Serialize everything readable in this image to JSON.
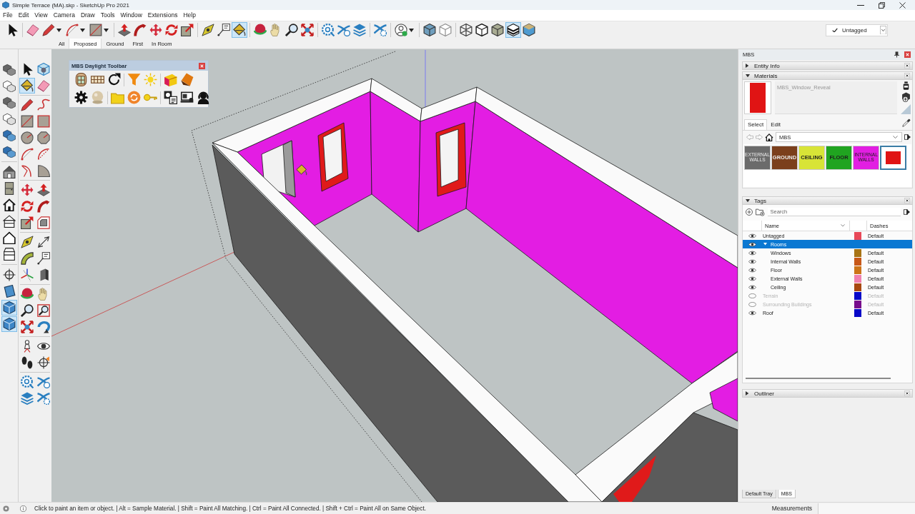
{
  "window": {
    "title": "Simple Terrace (MA).skp - SketchUp Pro 2021"
  },
  "menu_bar": [
    "File",
    "Edit",
    "View",
    "Camera",
    "Draw",
    "Tools",
    "Window",
    "Extensions",
    "Help"
  ],
  "main_toolbar": [
    {
      "selected": false
    },
    {
      "selected": false
    },
    {
      "selected": false
    },
    {
      "selected": false
    },
    {
      "selected": false
    },
    {
      "selected": false
    },
    {
      "selected": false
    },
    {
      "selected": false
    },
    {
      "selected": false
    },
    {
      "selected": false
    },
    {
      "selected": false
    },
    {
      "selected": false
    },
    {
      "selected": true
    },
    {
      "selected": false
    },
    {
      "selected": false
    },
    {
      "selected": false
    },
    {
      "selected": false
    },
    {
      "selected": false
    },
    {
      "selected": false
    },
    {
      "selected": false
    },
    {
      "selected": false
    },
    {
      "selected": false
    },
    {
      "selected": false
    },
    {
      "selected": false
    },
    {
      "selected": false
    },
    {
      "selected": false
    },
    {
      "selected": false
    },
    {
      "selected": true
    },
    {
      "selected": false
    }
  ],
  "tag_dropdown": {
    "value": "Untagged"
  },
  "scene_tabs": [
    {
      "label": "All",
      "selected": false
    },
    {
      "label": "Proposed",
      "selected": true
    },
    {
      "label": "Ground",
      "selected": false
    },
    {
      "label": "First",
      "selected": false
    },
    {
      "label": "In Room",
      "selected": false
    }
  ],
  "left_toolbar": {
    "column_1": [
      {
        "selected": false
      },
      {
        "selected": false
      },
      {
        "selected": false
      },
      {
        "selected": false
      },
      {
        "selected": false
      },
      {
        "selected": false
      },
      {
        "selected": false
      },
      {
        "selected": false
      },
      {
        "selected": false
      },
      {
        "selected": false
      },
      {
        "selected": false
      },
      {
        "selected": false
      },
      {
        "selected": false
      },
      {
        "selected": false
      },
      {
        "selected": true
      },
      {
        "selected": true
      }
    ],
    "column_2": [
      {
        "selected": false
      },
      {
        "selected": false
      },
      {
        "selected": true
      },
      {
        "selected": false
      },
      {
        "selected": false
      },
      {
        "selected": false
      },
      {
        "selected": false
      },
      {
        "selected": false
      },
      {
        "selected": false
      },
      {
        "selected": false
      },
      {
        "selected": false
      },
      {
        "selected": false
      },
      {
        "selected": false
      },
      {
        "selected": false
      },
      {
        "selected": false
      },
      {
        "selected": false
      },
      {
        "selected": false
      },
      {
        "selected": false
      },
      {
        "selected": false
      },
      {
        "selected": false
      },
      {
        "selected": false
      },
      {
        "selected": false
      },
      {
        "selected": false
      },
      {
        "selected": false
      },
      {
        "selected": false
      },
      {
        "selected": false
      },
      {
        "selected": false
      },
      {
        "selected": false
      },
      {
        "selected": false
      },
      {
        "selected": false
      },
      {
        "selected": false
      },
      {
        "selected": false
      },
      {
        "selected": false
      },
      {
        "selected": false
      },
      {
        "selected": false
      },
      {
        "selected": false
      },
      {
        "selected": false
      },
      {
        "selected": false
      },
      {
        "selected": false
      },
      {
        "selected": false
      }
    ]
  },
  "daylight_toolbar": {
    "title": "MBS Daylight Toolbar"
  },
  "tray": {
    "title": "MBS",
    "entity_info": {
      "title": "Entity Info",
      "expanded": false
    },
    "materials": {
      "title": "Materials",
      "expanded": true,
      "current_name": "MBS_Window_Reveal",
      "tabs": [
        {
          "label": "Select",
          "selected": true
        },
        {
          "label": "Edit",
          "selected": false
        }
      ],
      "library": "MBS",
      "swatches": [
        {
          "label": "EXTERNAL WALLS",
          "color": "#6b6b6b",
          "selected": false
        },
        {
          "label": "GROUND",
          "color": "#7b3f1c",
          "selected": false
        },
        {
          "label": "CEILING",
          "color": "#d8e437",
          "selected": false
        },
        {
          "label": "FLOOR",
          "color": "#20a420",
          "selected": false
        },
        {
          "label": "INTERNAL WALLS",
          "color": "#e21ee2",
          "selected": false
        },
        {
          "color": "#e01414",
          "selected": true
        }
      ]
    },
    "tags": {
      "title": "Tags",
      "expanded": true,
      "search_placeholder": "Search",
      "columns": [
        "Name",
        "Dashes"
      ],
      "rows": [
        {
          "name": "Untagged",
          "visible": true,
          "color": "#e84858",
          "dashes": "Default",
          "selected": false
        },
        {
          "name": "Rooms",
          "visible": true,
          "selected": true,
          "expanded": true,
          "children": [
            {
              "name": "Windows",
              "visible": true,
              "color": "#a87414",
              "dashes": "Default",
              "selected": false
            },
            {
              "name": "Internal Walls",
              "visible": true,
              "color": "#c85818",
              "dashes": "Default",
              "selected": false
            },
            {
              "name": "Floor",
              "visible": true,
              "color": "#cc7418",
              "dashes": "Default",
              "selected": false
            },
            {
              "name": "External Walls",
              "visible": true,
              "color": "#f080b0",
              "dashes": "Default",
              "selected": false
            },
            {
              "name": "Ceiling",
              "visible": true,
              "color": "#a84810",
              "dashes": "Default",
              "selected": false
            }
          ]
        },
        {
          "name": "Terrain",
          "visible": false,
          "color": "#0808c8",
          "dashes": "Default",
          "selected": false
        },
        {
          "name": "Surrounding Buildings",
          "visible": false,
          "color": "#780c8c",
          "dashes": "Default",
          "selected": false
        },
        {
          "name": "Roof",
          "visible": true,
          "color": "#0808c8",
          "dashes": "Default",
          "selected": false
        }
      ]
    },
    "outliner": {
      "title": "Outliner",
      "expanded": false
    },
    "tabs": [
      {
        "label": "Default Tray",
        "selected": false
      },
      {
        "label": "MBS",
        "selected": true
      }
    ]
  },
  "status_bar": {
    "message": "Click to paint an item or object. | Alt = Sample Material. | Shift = Paint All Matching. | Ctrl = Paint All Connected. | Shift + Ctrl = Paint All on Same Object.",
    "measurements_label": "Measurements"
  }
}
